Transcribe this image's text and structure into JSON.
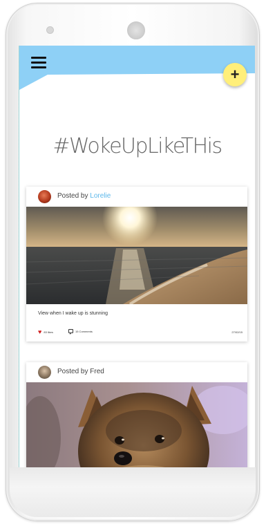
{
  "app": {
    "headline": "#WokeUpLikeTHis",
    "fab_label": "+"
  },
  "posts": [
    {
      "posted_by_prefix": "Posted by",
      "author": "Lorelie",
      "caption": "View when I wake up is stunning",
      "likes": "83 likes",
      "comments": "15 Comments",
      "date": "27/02/15"
    },
    {
      "posted_by_prefix": "Posted by",
      "author": "Fred"
    }
  ],
  "colors": {
    "header_band": "#8ed0f6",
    "fab": "#ffef7a",
    "author_link": "#5bb7ea",
    "like_heart": "#d01d1d"
  },
  "icons": [
    "hamburger-menu-icon",
    "plus-icon",
    "heart-icon",
    "comment-icon"
  ]
}
